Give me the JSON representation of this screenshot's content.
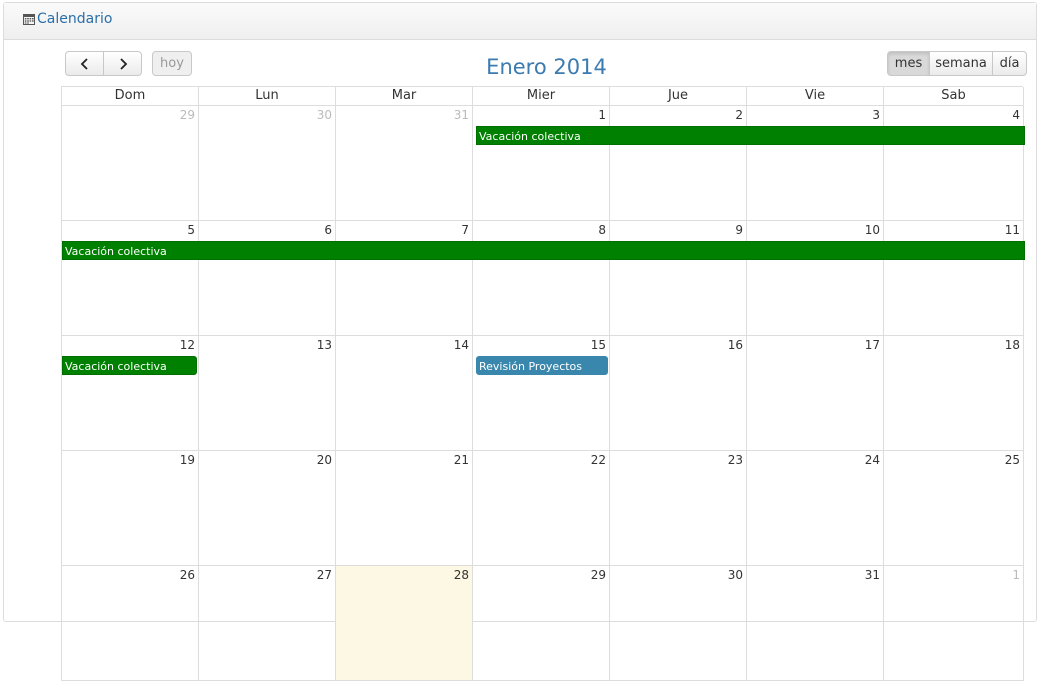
{
  "panel": {
    "title": "Calendario",
    "icon": "calendar-icon"
  },
  "toolbar": {
    "prev_icon": "chevron-left-icon",
    "next_icon": "chevron-right-icon",
    "today_label": "hoy",
    "title": "Enero 2014",
    "views": {
      "month": "mes",
      "week": "semana",
      "day": "día"
    },
    "active_view": "mes"
  },
  "weekdays": [
    "Dom",
    "Lun",
    "Mar",
    "Mier",
    "Jue",
    "Vie",
    "Sab"
  ],
  "weeks": [
    {
      "days": [
        "29",
        "30",
        "31",
        "1",
        "2",
        "3",
        "4"
      ]
    },
    {
      "days": [
        "5",
        "6",
        "7",
        "8",
        "9",
        "10",
        "11"
      ]
    },
    {
      "days": [
        "12",
        "13",
        "14",
        "15",
        "16",
        "17",
        "18"
      ]
    },
    {
      "days": [
        "19",
        "20",
        "21",
        "22",
        "23",
        "24",
        "25"
      ]
    },
    {
      "days": [
        "26",
        "27",
        "28",
        "29",
        "30",
        "31",
        "1"
      ]
    }
  ],
  "events": [
    {
      "title": "Vacación colectiva",
      "color": "#008000"
    },
    {
      "title": "Vacación colectiva",
      "color": "#008000"
    },
    {
      "title": "Vacación colectiva",
      "color": "#008000"
    },
    {
      "title": "Revisión Proyectos",
      "color": "#3a87ad"
    }
  ],
  "colors": {
    "accent": "#3b7bb0",
    "today_bg": "#fcf8e3"
  }
}
